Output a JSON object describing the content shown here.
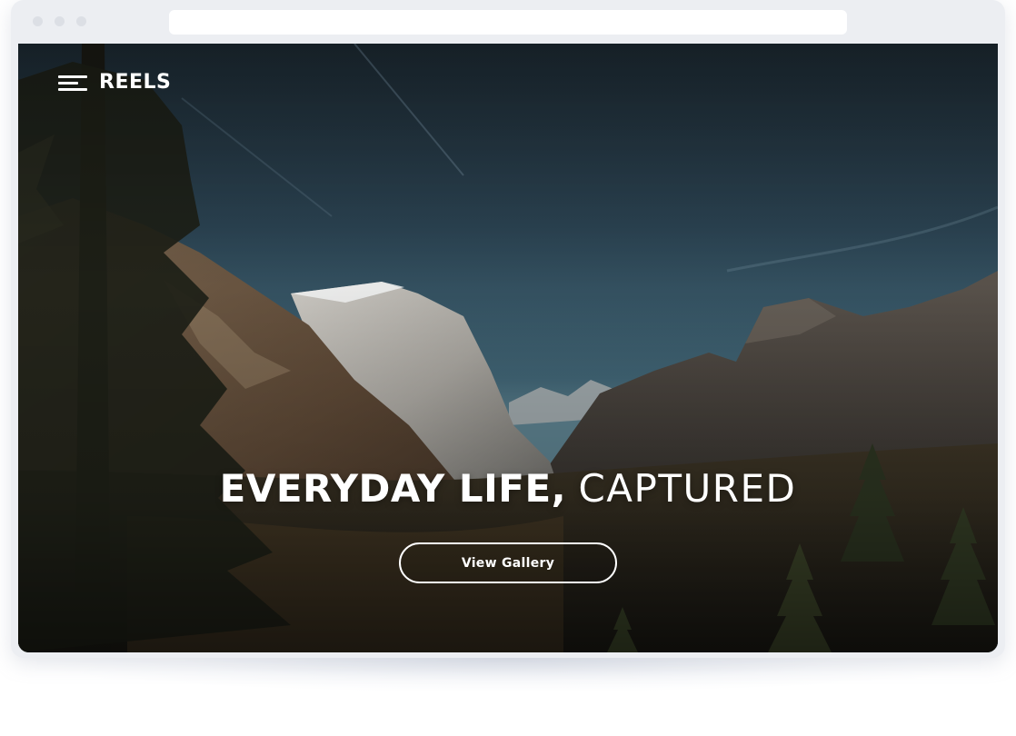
{
  "browser": {
    "address": ""
  },
  "nav": {
    "menu_icon": "hamburger-menu-icon",
    "brand": "REELS"
  },
  "hero": {
    "title_bold": "EVERYDAY LIFE,",
    "title_light": "CAPTURED",
    "button_label": "View Gallery",
    "background": "mountain-valley-photo"
  },
  "colors": {
    "text": "#ffffff",
    "sky": "#2e4656",
    "frame": "#eceef2"
  }
}
